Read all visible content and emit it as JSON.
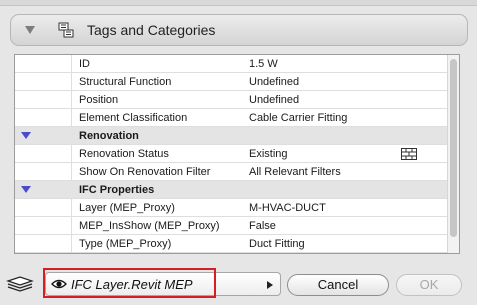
{
  "panel": {
    "title": "Tags and Categories",
    "icon": "tag-list-icon",
    "collapse_icon": "disclosure-triangle-icon"
  },
  "rows": [
    {
      "type": "property",
      "name": "ID",
      "value": "1.5 W"
    },
    {
      "type": "property",
      "name": "Structural Function",
      "value": "Undefined"
    },
    {
      "type": "property",
      "name": "Position",
      "value": "Undefined"
    },
    {
      "type": "property",
      "name": "Element Classification",
      "value": "Cable Carrier Fitting"
    },
    {
      "type": "section",
      "name": "Renovation"
    },
    {
      "type": "property",
      "name": "Renovation Status",
      "value": "Existing",
      "icon": "brick-wall-icon"
    },
    {
      "type": "property",
      "name": "Show On Renovation Filter",
      "value": "All Relevant Filters"
    },
    {
      "type": "section",
      "name": "IFC Properties"
    },
    {
      "type": "property",
      "name": "Layer (MEP_Proxy)",
      "value": "M-HVAC-DUCT"
    },
    {
      "type": "property",
      "name": "MEP_InsShow (MEP_Proxy)",
      "value": "False"
    },
    {
      "type": "property",
      "name": "Type (MEP_Proxy)",
      "value": "Duct Fitting"
    }
  ],
  "footer": {
    "layers_icon": "layers-stack-icon",
    "layer_visibility_icon": "eye-icon",
    "layer_value": "IFC Layer.Revit MEP",
    "cancel_label": "Cancel",
    "ok_label": "OK",
    "ok_enabled": false
  },
  "colors": {
    "section_triangle": "#4b4bd0",
    "highlight_border": "#d62020"
  }
}
